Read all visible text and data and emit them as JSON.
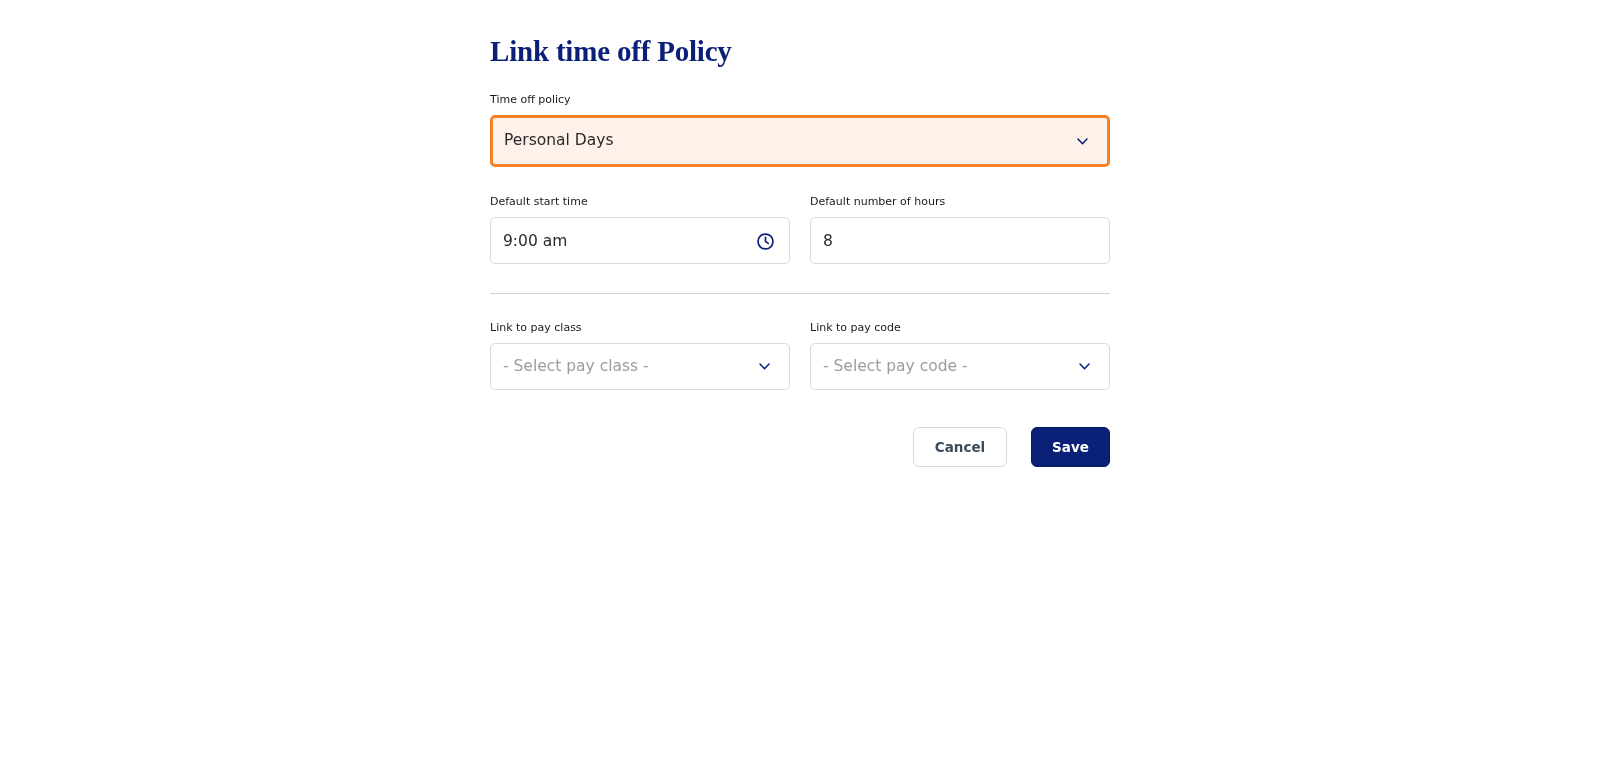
{
  "title": "Link time off Policy",
  "rows": [
    {
      "divider_before": false,
      "fields": [
        {
          "kind": "select",
          "label": "Time off policy",
          "value": "Personal Days",
          "focused": true
        }
      ]
    },
    {
      "divider_before": false,
      "fields": [
        {
          "kind": "time",
          "label": "Default start time",
          "value": "9:00 am",
          "focused": false
        },
        {
          "kind": "number",
          "label": "Default number of hours",
          "value": "8",
          "focused": false
        }
      ]
    },
    {
      "divider_before": true,
      "fields": [
        {
          "kind": "select",
          "label": "Link to pay class",
          "placeholder": "- Select pay class -",
          "focused": false
        },
        {
          "kind": "select",
          "label": "Link to pay code",
          "placeholder": "- Select pay code -",
          "focused": false
        }
      ]
    }
  ],
  "buttons": [
    {
      "kind": "secondary",
      "label": "Cancel"
    },
    {
      "kind": "primary",
      "label": "Save"
    }
  ]
}
